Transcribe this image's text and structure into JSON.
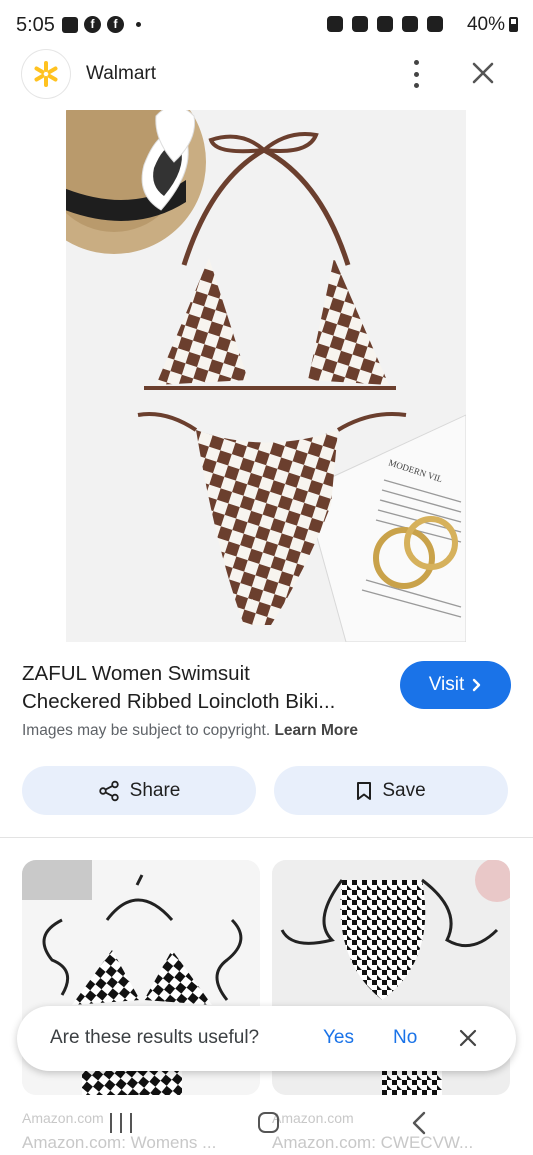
{
  "status": {
    "time": "5:05",
    "battery": "40%"
  },
  "header": {
    "site_name": "Walmart"
  },
  "result": {
    "title_line1": "ZAFUL Women Swimsuit",
    "title_line2": "Checkered Ribbed Loincloth Biki...",
    "visit_label": "Visit",
    "copyright_text": "Images may be subject to copyright.",
    "learn_more": "Learn More"
  },
  "actions": {
    "share_label": "Share",
    "save_label": "Save"
  },
  "feedback": {
    "question": "Are these results useful?",
    "yes": "Yes",
    "no": "No"
  },
  "related": [
    {
      "source": "Amazon.com",
      "title": "Amazon.com: Womens ..."
    },
    {
      "source": "Amazon.com",
      "title": "Amazon.com: CWECVW..."
    }
  ],
  "colors": {
    "accent": "#1a73e8",
    "chip_bg": "#e8effb",
    "walmart_yellow": "#ffc220",
    "print_brown": "#6b3f2e"
  }
}
